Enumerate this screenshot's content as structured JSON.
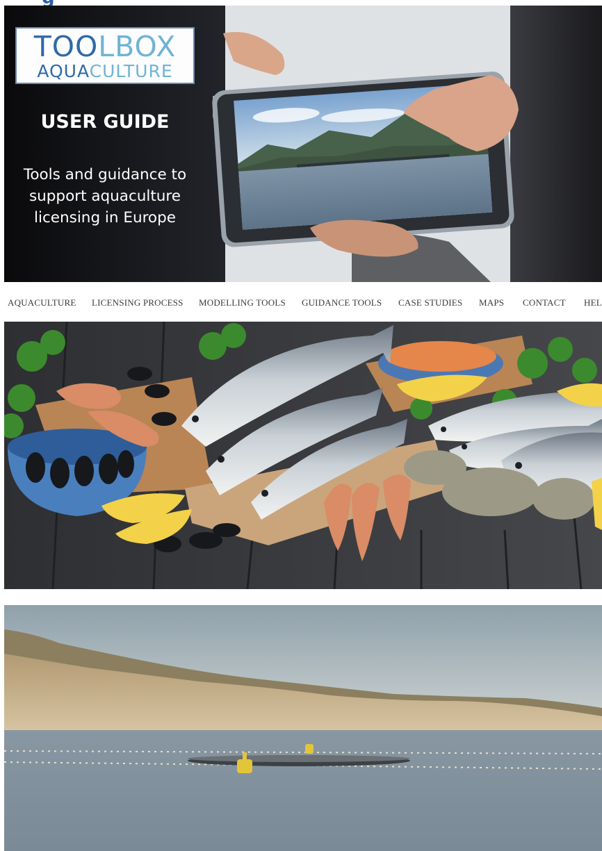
{
  "page": {
    "heading_fragment": "g"
  },
  "hero": {
    "logo_line1_dark": "TOO",
    "logo_line1_light": "LBOX",
    "logo_line2_dark": "AQUA",
    "logo_line2_light": "CULTURE",
    "title": "USER GUIDE",
    "subtitle_lines": [
      "Tools and guidance to",
      "support aquaculture",
      "licensing in Europe"
    ]
  },
  "nav": {
    "items": [
      "AQUACULTURE",
      "LICENSING PROCESS",
      "MODELLING TOOLS",
      "GUIDANCE TOOLS",
      "CASE STUDIES",
      "MAPS",
      "CONTACT",
      "HELP"
    ]
  },
  "colors": {
    "logo_dark": "#2f69a8",
    "logo_light": "#6fb3d6",
    "nav_text": "#3a3a3a"
  },
  "images": {
    "hero": "hands-holding-tablet-showing-fish-farm",
    "food": "seafood-spread-on-wooden-table",
    "sea": "fish-farm-cages-near-coastal-cliffs"
  }
}
